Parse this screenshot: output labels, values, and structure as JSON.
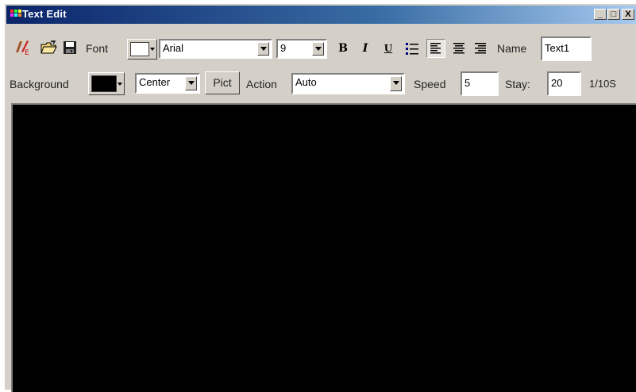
{
  "window": {
    "title": "Text Edit",
    "minimize": "_",
    "maximize": "□",
    "close": "X"
  },
  "toolbar1": {
    "font_label": "Font",
    "font_color": "#ffffff",
    "font_family": "Arial",
    "font_size": "9",
    "bold": "B",
    "italic": "I",
    "underline": "U",
    "name_label": "Name",
    "name_value": "Text1"
  },
  "toolbar2": {
    "background_label": "Background",
    "background_color": "#000000",
    "align_value": "Center",
    "pict_label": "Pict",
    "action_label": "Action",
    "action_value": "Auto",
    "speed_label": "Speed",
    "speed_value": "5",
    "stay_label": "Stay:",
    "stay_value": "20",
    "unit_label": "1/10S"
  },
  "icons": [
    "text-edit-icon",
    "open-folder-icon",
    "save-icon",
    "bullet-list-icon",
    "align-left-icon",
    "align-center-icon",
    "align-right-icon"
  ],
  "colors": {
    "canvas": "#000000",
    "titlebar": "#0a246a",
    "chrome": "#d4d0c8"
  }
}
